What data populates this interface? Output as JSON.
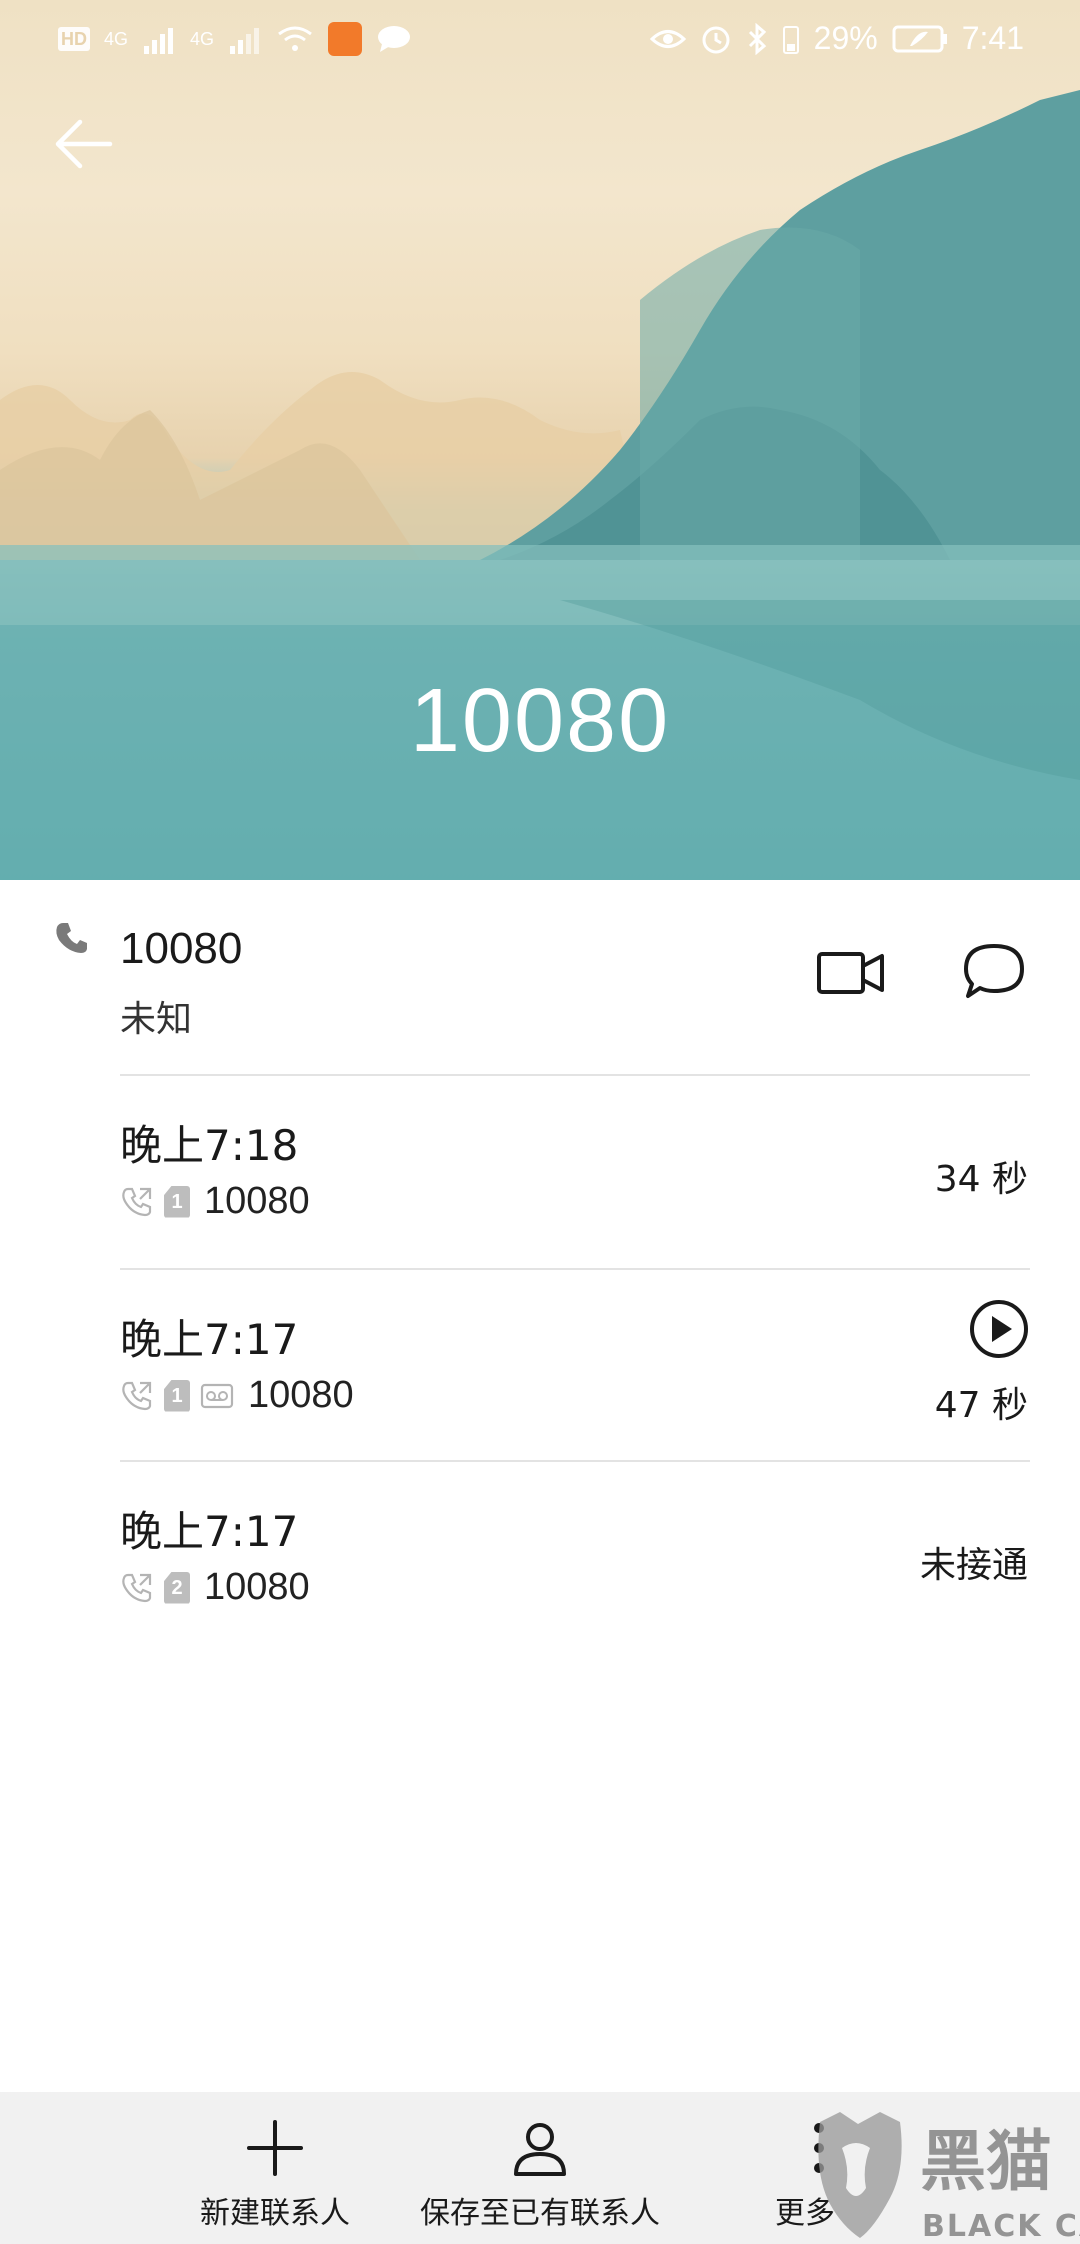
{
  "status_bar": {
    "left_badges": [
      "HD",
      "4G",
      "4G"
    ],
    "battery": "29%",
    "time": "7:41"
  },
  "header": {
    "title": "10080",
    "back_icon": "arrow-left-icon"
  },
  "contact": {
    "number": "10080",
    "label": "未知",
    "actions": [
      "video-call-icon",
      "message-icon"
    ]
  },
  "call_log": [
    {
      "time": "晚上7:18",
      "sim": "1",
      "voicemail": false,
      "number": "10080",
      "duration": "34 秒",
      "has_play": false
    },
    {
      "time": "晚上7:17",
      "sim": "1",
      "voicemail": true,
      "number": "10080",
      "duration": "47 秒",
      "has_play": true
    },
    {
      "time": "晚上7:17",
      "sim": "2",
      "voicemail": false,
      "number": "10080",
      "status": "未接通",
      "has_play": false
    }
  ],
  "bottom_bar": {
    "new_contact": "新建联系人",
    "save_existing": "保存至已有联系人",
    "more": "更多"
  },
  "watermark": {
    "text_cn": "黑猫",
    "text_en": "BLACK CAT"
  },
  "colors": {
    "accent_teal": "#5aa8ab",
    "sky": "#efe1c4",
    "divider": "#e3e3e3",
    "bottom_bar_bg": "#f1f1f1"
  }
}
